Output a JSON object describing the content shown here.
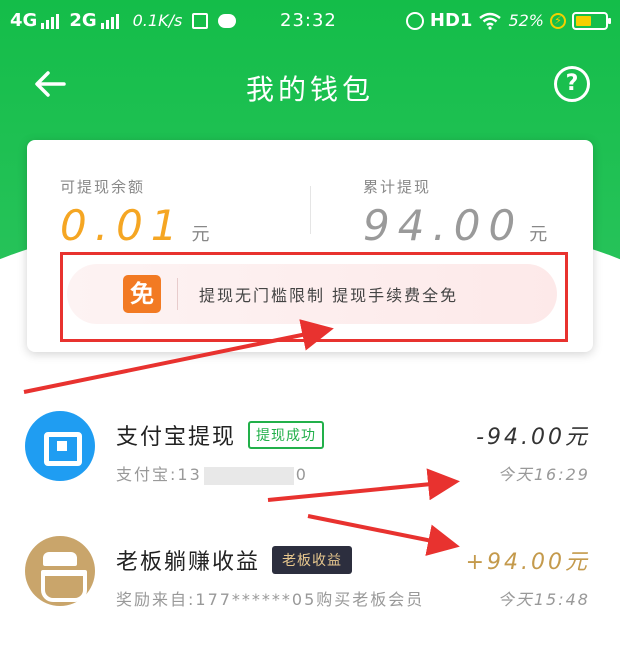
{
  "status_bar": {
    "network_1": "4G",
    "network_2": "2G",
    "speed": "0.1K/s",
    "time": "23:32",
    "hd": "HD1",
    "battery": "52%"
  },
  "header": {
    "title": "我的钱包",
    "help": "?"
  },
  "card": {
    "withdrawable_label": "可提现余额",
    "withdrawable_value": "0.01",
    "withdrawable_unit": "元",
    "total_label": "累计提现",
    "total_value": "94.00",
    "total_unit": "元",
    "promo_badge": "免",
    "promo_text": "提现无门槛限制 提现手续费全免"
  },
  "transactions": [
    {
      "title": "支付宝提现",
      "tag": "提现成功",
      "sub_prefix": "支付宝:13",
      "sub_suffix": "0",
      "amount": "-94.00元",
      "time": "今天16:29"
    },
    {
      "title": "老板躺赚收益",
      "tag": "老板收益",
      "sub": "奖励来自:177******05购买老板会员",
      "amount": "+94.00元",
      "time": "今天15:48"
    }
  ],
  "colors": {
    "brand_green": "#14bd49",
    "balance_orange": "#f5a623",
    "annotation_red": "#e8322f",
    "income_gold": "#c49a4c"
  }
}
